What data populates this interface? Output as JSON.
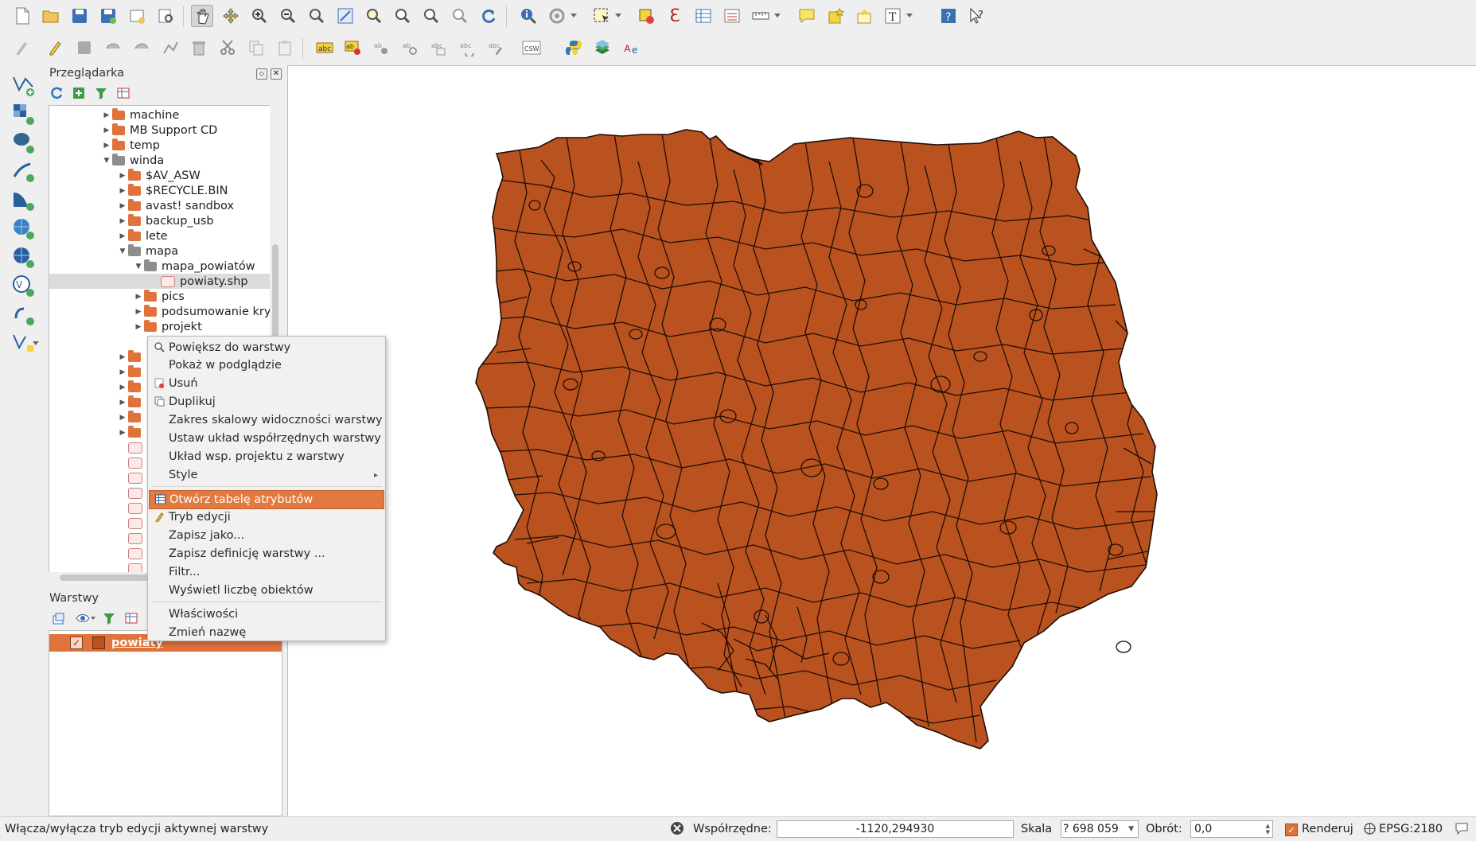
{
  "browser": {
    "title": "Przeglądarka",
    "tree": [
      {
        "label": "machine"
      },
      {
        "label": "MB Support CD"
      },
      {
        "label": "temp"
      },
      {
        "label": "winda"
      },
      {
        "label": "$AV_ASW"
      },
      {
        "label": "$RECYCLE.BIN"
      },
      {
        "label": "avast! sandbox"
      },
      {
        "label": "backup_usb"
      },
      {
        "label": "lete"
      },
      {
        "label": "mapa"
      },
      {
        "label": "mapa_powiatów"
      },
      {
        "label": "powiaty.shp"
      },
      {
        "label": "pics"
      },
      {
        "label": "podsumowanie kryt"
      },
      {
        "label": "projekt"
      }
    ]
  },
  "layers": {
    "title": "Warstwy",
    "items": [
      {
        "label": "powiaty",
        "checked": true,
        "color": "#b9521f"
      }
    ]
  },
  "context_menu": {
    "items": [
      {
        "label": "Powiększ do warstwy",
        "icon": "zoom-icon"
      },
      {
        "label": "Pokaż w podglądzie"
      },
      {
        "label": "Usuń",
        "icon": "remove-icon"
      },
      {
        "label": "Duplikuj",
        "icon": "duplicate-icon"
      },
      {
        "label": "Zakres skalowy widoczności warstwy"
      },
      {
        "label": "Ustaw układ współrzędnych warstwy"
      },
      {
        "label": "Układ wsp. projektu z warstwy"
      },
      {
        "label": "Style",
        "submenu": true
      },
      {
        "label": "Otwórz tabelę atrybutów",
        "icon": "table-icon",
        "highlighted": true
      },
      {
        "label": "Tryb edycji",
        "icon": "pencil-icon"
      },
      {
        "label": "Zapisz jako..."
      },
      {
        "label": "Zapisz definicję warstwy ..."
      },
      {
        "label": "Filtr..."
      },
      {
        "label": "Wyświetl liczbę obiektów"
      },
      {
        "label": "Właściwości"
      },
      {
        "label": "Zmień nazwę"
      }
    ]
  },
  "map": {
    "fill_color": "#b9521f",
    "stroke_color": "#1f0d05"
  },
  "statusbar": {
    "message": "Włącza/wyłącza tryb edycji aktywnej warstwy",
    "coords_label": "Współrzędne:",
    "coords_value": "-1120,294930",
    "scale_label": "Skala",
    "scale_value": "? 698 059",
    "rotation_label": "Obrót:",
    "rotation_value": "0,0",
    "render_label": "Renderuj",
    "crs_label": "EPSG:2180"
  },
  "colors": {
    "accent": "#e27a3f",
    "map_fill": "#b9521f"
  }
}
